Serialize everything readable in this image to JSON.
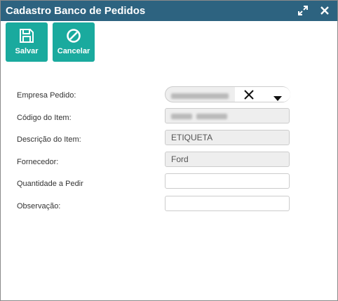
{
  "window": {
    "title": "Cadastro Banco de Pedidos"
  },
  "toolbar": {
    "save_label": "Salvar",
    "cancel_label": "Cancelar"
  },
  "form": {
    "empresa_label": "Empresa Pedido:",
    "codigo_label": "Código do Item:",
    "descricao_label": "Descrição do Item:",
    "descricao_value": "ETIQUETA",
    "fornecedor_label": "Fornecedor:",
    "fornecedor_value": "Ford",
    "quantidade_label": "Quantidade a Pedir",
    "quantidade_value": "",
    "observacao_label": "Observação:",
    "observacao_value": ""
  },
  "colors": {
    "titlebar": "#2d6380",
    "accent_button": "#1aaa9e"
  },
  "icons": [
    "expand-icon",
    "close-icon",
    "floppy-disk-icon",
    "cancel-icon",
    "clear-icon",
    "caret-down-icon"
  ]
}
